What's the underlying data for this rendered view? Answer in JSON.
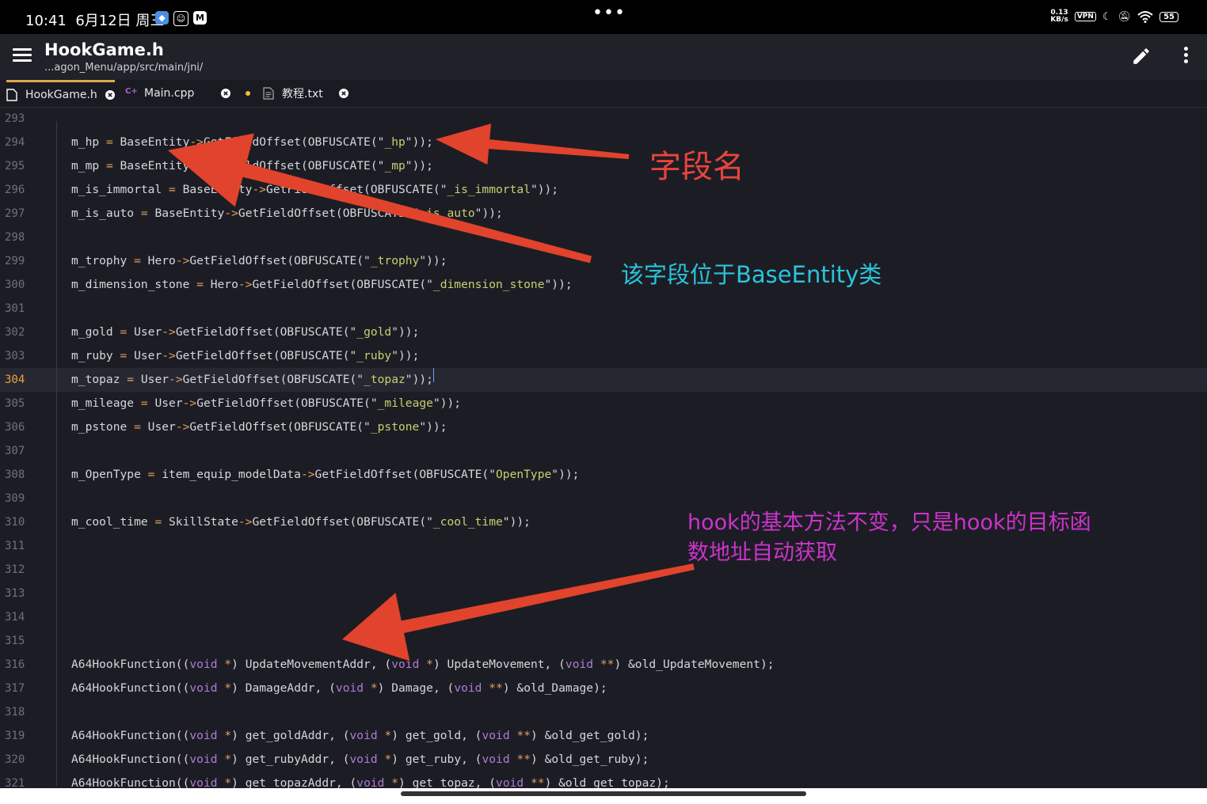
{
  "status_bar": {
    "time": "10:41",
    "date": "6月12日 周三",
    "net_speed": "0.13\nKB/s",
    "vpn": "VPN",
    "battery": "55"
  },
  "app_bar": {
    "title": "HookGame.h",
    "path": "...agon_Menu/app/src/main/jni/"
  },
  "tabs": [
    {
      "label": "HookGame.h",
      "active": true,
      "modified": false
    },
    {
      "label": "Main.cpp",
      "active": false,
      "modified": true
    },
    {
      "label": "教程.txt",
      "active": false,
      "modified": false
    }
  ],
  "editor": {
    "current_line": 304,
    "lines": [
      {
        "n": "293",
        "code": ""
      },
      {
        "n": "294",
        "code": "m_hp = BaseEntity->GetFieldOffset(OBFUSCATE(\"_hp\"));"
      },
      {
        "n": "295",
        "code": "m_mp = BaseEntity->GetFieldOffset(OBFUSCATE(\"_mp\"));"
      },
      {
        "n": "296",
        "code": "m_is_immortal = BaseEntity->GetFieldOffset(OBFUSCATE(\"_is_immortal\"));"
      },
      {
        "n": "297",
        "code": "m_is_auto = BaseEntity->GetFieldOffset(OBFUSCATE(\"_is_auto\"));"
      },
      {
        "n": "298",
        "code": ""
      },
      {
        "n": "299",
        "code": "m_trophy = Hero->GetFieldOffset(OBFUSCATE(\"_trophy\"));"
      },
      {
        "n": "300",
        "code": "m_dimension_stone = Hero->GetFieldOffset(OBFUSCATE(\"_dimension_stone\"));"
      },
      {
        "n": "301",
        "code": ""
      },
      {
        "n": "302",
        "code": "m_gold = User->GetFieldOffset(OBFUSCATE(\"_gold\"));"
      },
      {
        "n": "303",
        "code": "m_ruby = User->GetFieldOffset(OBFUSCATE(\"_ruby\"));"
      },
      {
        "n": "304",
        "code": "m_topaz = User->GetFieldOffset(OBFUSCATE(\"_topaz\"));"
      },
      {
        "n": "305",
        "code": "m_mileage = User->GetFieldOffset(OBFUSCATE(\"_mileage\"));"
      },
      {
        "n": "306",
        "code": "m_pstone = User->GetFieldOffset(OBFUSCATE(\"_pstone\"));"
      },
      {
        "n": "307",
        "code": ""
      },
      {
        "n": "308",
        "code": "m_OpenType = item_equip_modelData->GetFieldOffset(OBFUSCATE(\"OpenType\"));"
      },
      {
        "n": "309",
        "code": ""
      },
      {
        "n": "310",
        "code": "m_cool_time = SkillState->GetFieldOffset(OBFUSCATE(\"_cool_time\"));"
      },
      {
        "n": "311",
        "code": ""
      },
      {
        "n": "312",
        "code": ""
      },
      {
        "n": "313",
        "code": ""
      },
      {
        "n": "314",
        "code": ""
      },
      {
        "n": "315",
        "code": ""
      },
      {
        "n": "316",
        "code": "A64HookFunction((void *) UpdateMovementAddr, (void *) UpdateMovement, (void **) &old_UpdateMovement);"
      },
      {
        "n": "317",
        "code": "A64HookFunction((void *) DamageAddr, (void *) Damage, (void **) &old_Damage);"
      },
      {
        "n": "318",
        "code": ""
      },
      {
        "n": "319",
        "code": "A64HookFunction((void *) get_goldAddr, (void *) get_gold, (void **) &old_get_gold);"
      },
      {
        "n": "320",
        "code": "A64HookFunction((void *) get_rubyAddr, (void *) get_ruby, (void **) &old_get_ruby);"
      },
      {
        "n": "321",
        "code": "A64HookFunction((void *) get_topazAddr, (void *) get_topaz, (void **) &old_get_topaz);"
      }
    ]
  },
  "annotations": {
    "field_name": "字段名",
    "class_note": "该字段位于BaseEntity类",
    "hook_note": "hook的基本方法不变，只是hook的目标函\n数地址自动获取",
    "arrow_color": "#e2432c"
  }
}
